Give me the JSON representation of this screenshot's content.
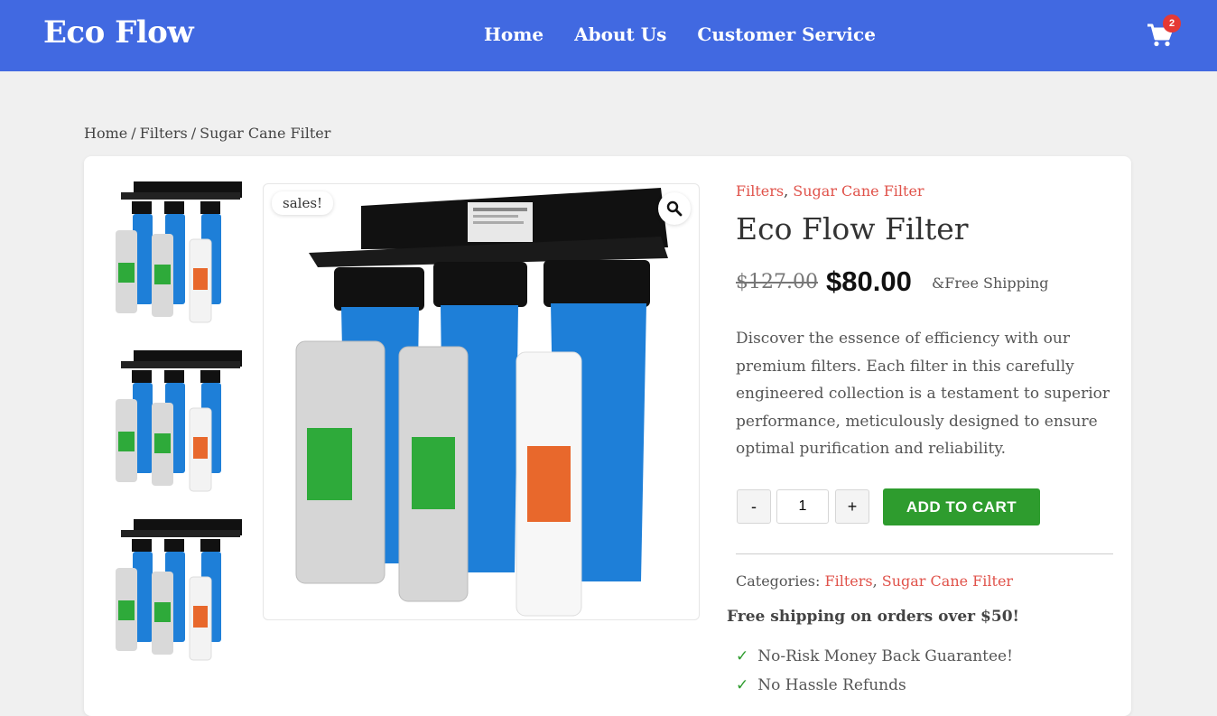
{
  "header": {
    "logo": "Eco Flow",
    "nav": [
      "Home",
      "About Us",
      "Customer Service"
    ],
    "cart_count": "2"
  },
  "breadcrumb": {
    "home": "Home",
    "category": "Filters",
    "current": "Sugar Cane Filter",
    "separator": "/"
  },
  "gallery": {
    "sale_badge": "sales!",
    "zoom_icon": "magnifier-icon"
  },
  "product": {
    "categories_top": [
      "Filters",
      "Sugar Cane Filter"
    ],
    "title": "Eco Flow Filter",
    "old_price": "$127.00",
    "new_price": "$80.00",
    "shipping_note": "&Free Shipping",
    "description": "Discover the essence of efficiency with our premium filters. Each filter in this carefully engineered collection is a testament to superior performance, meticulously designed to ensure optimal purification and reliability.",
    "quantity": "1",
    "minus_label": "-",
    "plus_label": "+",
    "add_to_cart": "ADD TO CART",
    "categories_label": "Categories:",
    "categories_bottom": [
      "Filters",
      "Sugar Cane Filter"
    ],
    "free_shipping": "Free shipping on orders over $50!",
    "perks": [
      "No-Risk Money Back Guarantee!",
      "No Hassle Refunds"
    ],
    "check_glyph": "✓"
  },
  "colors": {
    "header_bg": "#4169e1",
    "accent_link": "#e0524a",
    "button_green": "#2e9c2e",
    "badge_red": "#e53935"
  }
}
